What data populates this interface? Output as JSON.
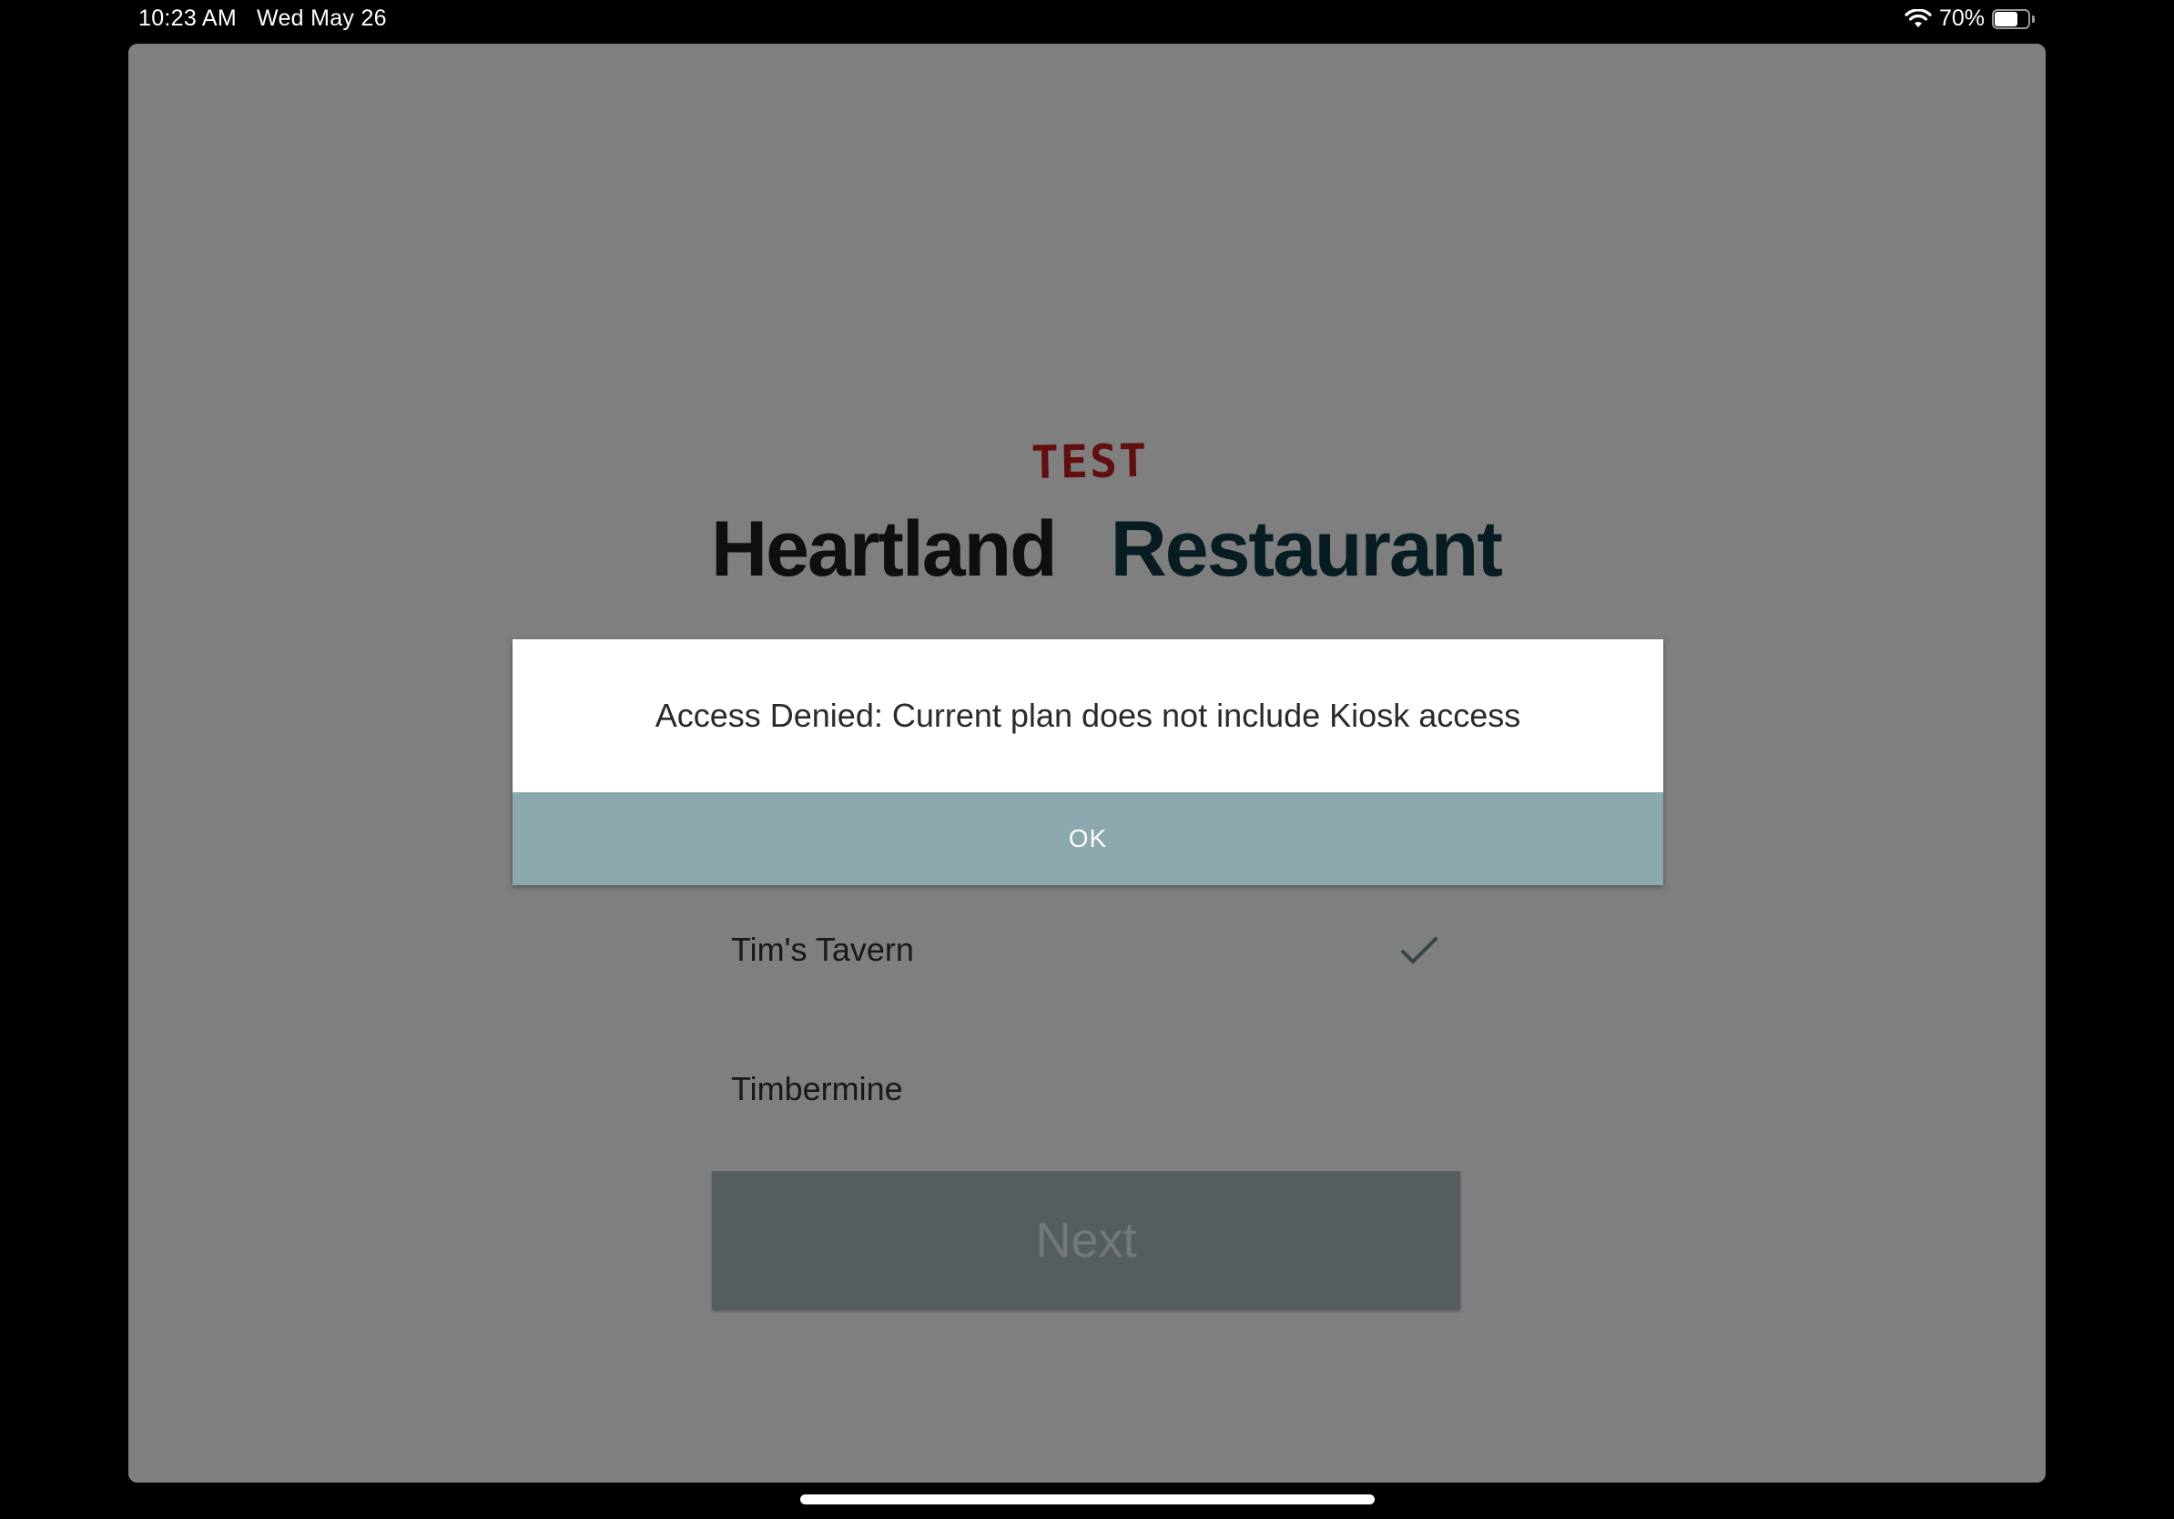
{
  "status_bar": {
    "time": "10:23 AM",
    "date": "Wed May 26",
    "battery_percent": "70%",
    "battery_level": 0.7,
    "wifi_icon": "wifi-icon",
    "battery_icon": "battery-icon"
  },
  "header": {
    "test_label": "TEST",
    "brand_word1": "Heartland",
    "brand_word2": "Restaurant"
  },
  "location_list": {
    "items": [
      {
        "label": "Tim's Tavern",
        "selected": true
      },
      {
        "label": "Timbermine",
        "selected": false
      }
    ]
  },
  "next_button": {
    "label": "Next"
  },
  "alert": {
    "message": "Access Denied: Current plan does not include Kiosk access",
    "ok_label": "OK"
  },
  "colors": {
    "brand_heartland": "#1f1f1f",
    "brand_restaurant": "#0e3b45",
    "test_label": "#c41e1e",
    "next_button": "#a8bcc0",
    "alert_button": "#8aa8ad"
  }
}
